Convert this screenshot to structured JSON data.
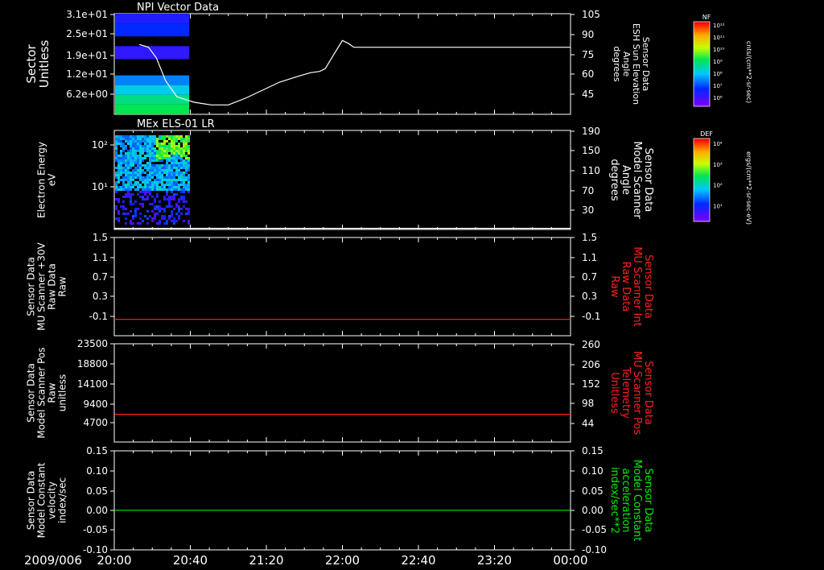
{
  "colors": {
    "background": "#000000",
    "axes": "#ffffff",
    "red_trace": "#ff2020",
    "green_trace": "#00ee00",
    "white_trace": "#ffffff"
  },
  "time_axis": {
    "date_label": "2009/006",
    "ticks": [
      "20:00",
      "20:40",
      "21:20",
      "22:00",
      "22:40",
      "23:20",
      "00:00"
    ],
    "start_hours": 20,
    "end_hours": 24
  },
  "panels": [
    {
      "id": "npi",
      "title": "NPI Vector Data",
      "left_label": [
        "Sector",
        "Unitless"
      ],
      "left_ticks": [
        "3.1e+01",
        "2.5e+01",
        "1.9e+01",
        "1.2e+01",
        "6.2e+00"
      ],
      "right_label": [
        "Sensor Data",
        "ESH Sun Elevation",
        "Angle",
        "degrees"
      ],
      "right_ticks": [
        "105",
        "90",
        "75",
        "60",
        "45"
      ],
      "right_label_color": "#ffffff"
    },
    {
      "id": "els",
      "title": "MEx ELS-01 LR",
      "left_label": [
        "Electron Energy",
        "eV"
      ],
      "left_ticks": [
        "10²",
        "10¹"
      ],
      "right_label": [
        "Sensor Data",
        "Model Scanner",
        "Angle",
        "degrees"
      ],
      "right_ticks": [
        "190",
        "150",
        "110",
        "70",
        "30"
      ],
      "right_label_color": "#ffffff"
    },
    {
      "id": "mu_int",
      "title": "",
      "left_label": [
        "Sensor Data",
        "MU Scanner +30V",
        "Raw Data",
        "Raw"
      ],
      "left_ticks": [
        "1.5",
        "1.1",
        "0.7",
        "0.3",
        "-0.1"
      ],
      "right_label": [
        "Sensor Data",
        "MU Scanner Int",
        "Raw Data",
        "Raw"
      ],
      "right_ticks": [
        "1.5",
        "1.1",
        "0.7",
        "0.3",
        "-0.1"
      ],
      "right_label_color": "#ff2020"
    },
    {
      "id": "mu_pos",
      "title": "",
      "left_label": [
        "Sensor Data",
        "Model Scanner Pos",
        "Raw",
        "unitless"
      ],
      "left_ticks": [
        "23500",
        "18800",
        "14100",
        "9400",
        "4700"
      ],
      "right_label": [
        "Sensor Data",
        "MU Scanner Pos",
        "Telemetry",
        "Unitless"
      ],
      "right_ticks": [
        "260",
        "206",
        "152",
        "98",
        "44"
      ],
      "right_label_color": "#ff2020"
    },
    {
      "id": "model",
      "title": "",
      "left_label": [
        "Sensor Data",
        "Model Constant",
        "velocity",
        "index/sec"
      ],
      "left_ticks": [
        "0.15",
        "0.10",
        "0.05",
        "0.00",
        "-0.05",
        "-0.10"
      ],
      "right_label": [
        "Sensor Data",
        "Model Constant",
        "acceleration",
        "index/sec**2"
      ],
      "right_ticks": [
        "0.15",
        "0.10",
        "0.05",
        "0.00",
        "-0.05",
        "-0.10"
      ],
      "right_label_color": "#00ee00"
    }
  ],
  "colorbars": [
    {
      "id": "nf",
      "title": "NF",
      "units": "cnts/(cm**2-sr-sec)",
      "ticks": [
        "10¹²",
        "10¹¹",
        "10¹⁰",
        "10⁹",
        "10⁸",
        "10⁷",
        "10⁶"
      ]
    },
    {
      "id": "def",
      "title": "DEF",
      "units": "ergs/(cm**2-sr-sec-eV)",
      "ticks": [
        "10⁴",
        "10³",
        "10²",
        "10¹"
      ]
    }
  ],
  "chart_data": [
    {
      "type": "line",
      "panel": "npi",
      "series": [
        {
          "name": "ESH Sun Elevation Angle",
          "axis": "right",
          "color": "#ffffff",
          "x": [
            20.22,
            20.3,
            20.37,
            20.45,
            20.55,
            20.7,
            20.85,
            21.0,
            21.15,
            21.3,
            21.45,
            21.6,
            21.72,
            21.8,
            21.85,
            21.92,
            22.0,
            22.05,
            22.1,
            23.3,
            24.0
          ],
          "values": [
            82,
            80,
            72,
            55,
            43,
            39,
            37,
            37,
            42,
            48,
            54,
            58,
            61,
            62,
            64,
            74,
            85,
            83,
            80,
            80,
            80
          ]
        }
      ],
      "ylim_right": [
        30,
        105
      ]
    },
    {
      "type": "line",
      "panel": "els",
      "series": [
        {
          "name": "Model Scanner Angle",
          "axis": "right",
          "color": "#ffffff",
          "x": [
            20.0,
            24.0
          ],
          "values": [
            12,
            12
          ]
        }
      ],
      "ylim_right": [
        10,
        190
      ]
    },
    {
      "type": "line",
      "panel": "mu_int",
      "series": [
        {
          "name": "MU Scanner Int Raw Data",
          "axis": "right",
          "color": "#ff2020",
          "x": [
            20.0,
            24.0
          ],
          "values": [
            0.0,
            0.0
          ]
        }
      ],
      "ylim": [
        -0.3,
        1.5
      ]
    },
    {
      "type": "line",
      "panel": "mu_pos",
      "series": [
        {
          "name": "MU Scanner Pos Telemetry",
          "axis": "right",
          "color": "#ff2020",
          "x": [
            20.0,
            24.0
          ],
          "values": [
            84,
            84
          ]
        }
      ],
      "ylim_right": [
        15,
        260
      ]
    },
    {
      "type": "line",
      "panel": "model",
      "series": [
        {
          "name": "Model Constant acceleration",
          "axis": "right",
          "color": "#00ee00",
          "x": [
            20.0,
            24.0
          ],
          "values": [
            0.0,
            0.0
          ]
        }
      ],
      "ylim": [
        -0.1,
        0.15
      ]
    },
    {
      "type": "heatmap",
      "panel": "npi",
      "xlim": [
        20.0,
        20.65
      ],
      "description_bands": [
        {
          "ylo": 28,
          "yhi": 31,
          "level": 0.15
        },
        {
          "ylo": 24,
          "yhi": 28,
          "level": 0.2
        },
        {
          "ylo": 21,
          "yhi": 24,
          "level": 0.0
        },
        {
          "ylo": 17,
          "yhi": 21,
          "level": 0.12
        },
        {
          "ylo": 12,
          "yhi": 17,
          "level": 0.0
        },
        {
          "ylo": 9,
          "yhi": 12,
          "level": 0.3
        },
        {
          "ylo": 6,
          "yhi": 9,
          "level": 0.4
        },
        {
          "ylo": 3,
          "yhi": 6,
          "level": 0.5
        },
        {
          "ylo": 0,
          "yhi": 3,
          "level": 0.55
        }
      ]
    },
    {
      "type": "heatmap",
      "panel": "els",
      "xlim": [
        20.0,
        20.65
      ],
      "ylim_log": [
        1,
        170
      ]
    }
  ]
}
